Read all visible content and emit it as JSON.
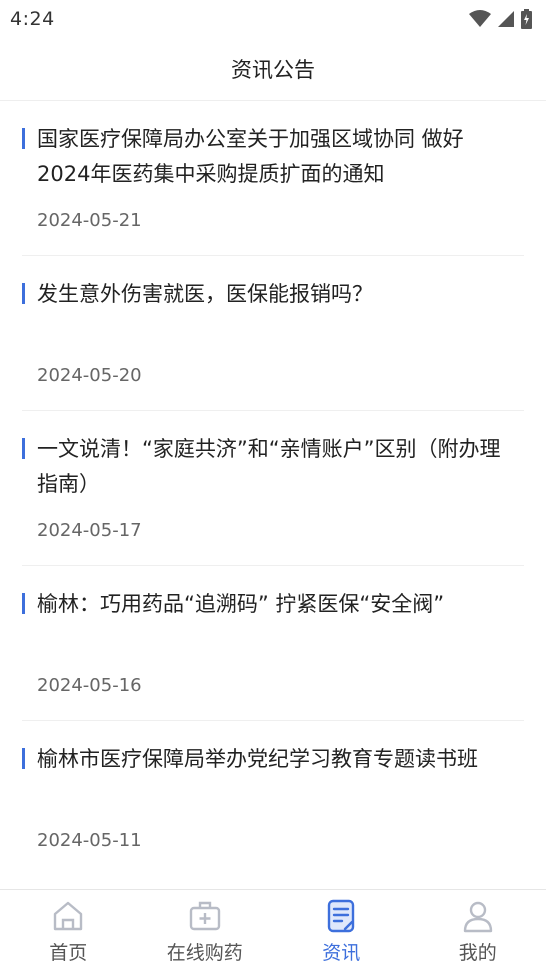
{
  "status": {
    "time": "4:24"
  },
  "header": {
    "title": "资讯公告"
  },
  "news": [
    {
      "title": "国家医疗保障局办公室关于加强区域协同 做好2024年医药集中采购提质扩面的通知",
      "date": "2024-05-21"
    },
    {
      "title": "发生意外伤害就医，医保能报销吗？",
      "date": "2024-05-20"
    },
    {
      "title": "一文说清！“家庭共济”和“亲情账户”区别（附办理指南）",
      "date": "2024-05-17"
    },
    {
      "title": "榆林：巧用药品“追溯码” 拧紧医保“安全阀”",
      "date": "2024-05-16"
    },
    {
      "title": "榆林市医疗保障局举办党纪学习教育专题读书班",
      "date": "2024-05-11"
    }
  ],
  "tabbar": {
    "tabs": [
      {
        "label": "首页",
        "icon": "home-icon"
      },
      {
        "label": "在线购药",
        "icon": "medicine-box-icon"
      },
      {
        "label": "资讯",
        "icon": "news-icon",
        "active": true
      },
      {
        "label": "我的",
        "icon": "user-icon"
      }
    ]
  },
  "colors": {
    "accent": "#3d6fdc",
    "icon_inactive": "#b8bcc6"
  }
}
